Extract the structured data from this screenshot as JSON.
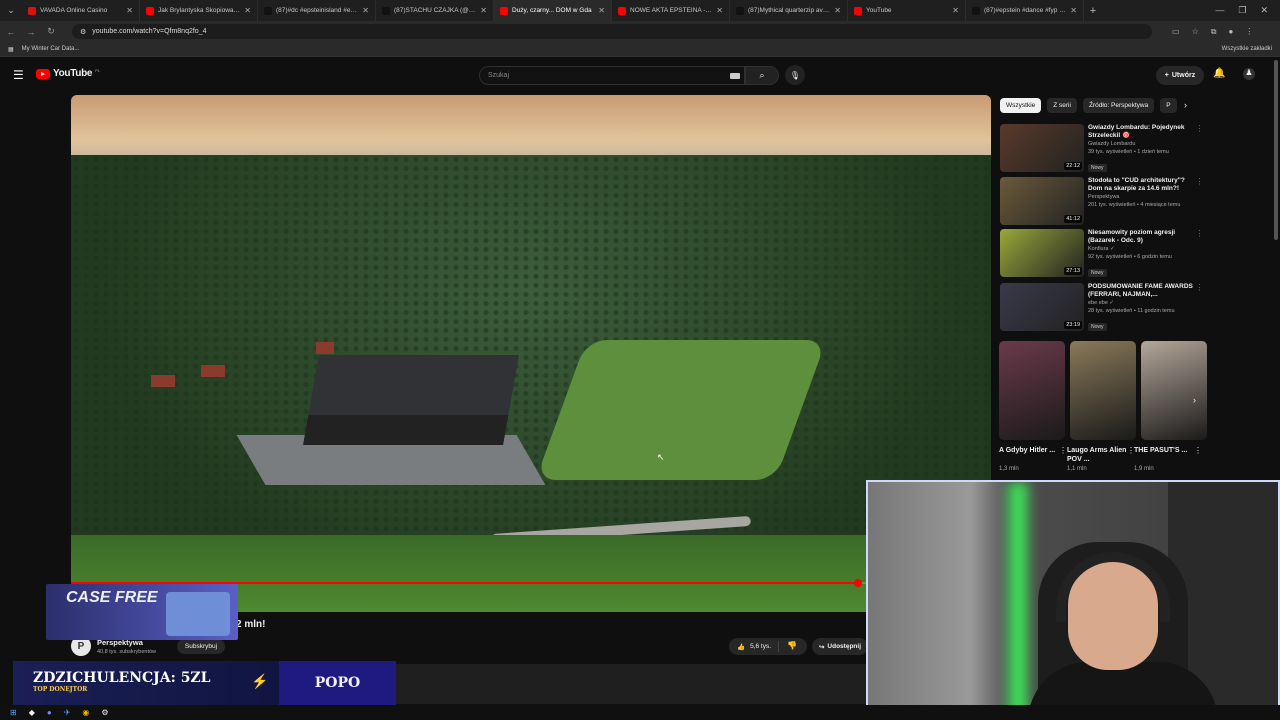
{
  "browser": {
    "tabs": [
      {
        "title": "VAVADA Online Casino",
        "color": "#d11"
      },
      {
        "title": "Jak Brylantyska Skopiowała Św",
        "color": "#f00"
      },
      {
        "title": "(87)#dc #epsteinisland #epstein",
        "color": "#111"
      },
      {
        "title": "(87)STACHU CZAJKA (@stachu",
        "color": "#111"
      },
      {
        "title": "Duży, czarny... DOM w Gda",
        "color": "#f00",
        "active": true
      },
      {
        "title": "NOWE AKTA EPSTEINA - TRUM",
        "color": "#f00"
      },
      {
        "title": "(87)Mythical quarterzip availabl",
        "color": "#111"
      },
      {
        "title": "YouTube",
        "color": "#f00"
      },
      {
        "title": "(87)#epstein #dance #fyp #me",
        "color": "#111"
      }
    ],
    "url": "youtube.com/watch?v=Qfm8nq2fo_4",
    "bookmarks": {
      "item": "My Winter Car Data...",
      "all": "Wszystkie zakładki"
    }
  },
  "youtube": {
    "logo": "YouTube",
    "logo_region": "PL",
    "search_placeholder": "Szukaj",
    "create_label": "Utwórz",
    "chips": [
      "Wszystkie",
      "Z serii",
      "Źródło: Perspektywa",
      "P"
    ],
    "recommended": [
      {
        "title": "Gwiazdy Lombardu: Pojedynek Strzeleckil 🎯",
        "channel": "Gwiazdy Lombardu",
        "views": "39 tys. wyświetleń • 1 dzień temu",
        "badge": "Nowy",
        "duration": "22:12",
        "thumb": "#5a3a2a"
      },
      {
        "title": "Stodoła to \"CUD architektury\"? Dom na skarpie za 14.6 mln?!",
        "channel": "Perspektywa",
        "views": "201 tys. wyświetleń • 4 miesiące temu",
        "badge": "",
        "duration": "41:12",
        "thumb": "#6b5a3a"
      },
      {
        "title": "Niesamowity poziom agresji (Bazarek - Odc. 9)",
        "channel": "Konfiura ✓",
        "views": "92 tys. wyświetleń • 6 godzin temu",
        "badge": "Nowy",
        "duration": "27:13",
        "thumb": "#9aa83a"
      },
      {
        "title": "PODSUMOWANIE FAME AWARDS (FERRARI, NAJMAN,...",
        "channel": "ebe ebe ✓",
        "views": "28 tys. wyświetleń • 11 godzin temu",
        "badge": "Nowy",
        "duration": "23:19",
        "thumb": "#3a3a4a"
      }
    ],
    "shorts": [
      {
        "title": "A Gdyby Hitler ...",
        "views": "1,3 mln",
        "color": "#6b3a4a"
      },
      {
        "title": "Laugo Arms Alien POV ...",
        "views": "1,1 mln",
        "color": "#8a7a5a"
      },
      {
        "title": "THE PASUT'S ...",
        "views": "1,9 mln",
        "color": "#b5a79a"
      }
    ],
    "video": {
      "title_visible": "2 mln!",
      "channel": "Perspektywa",
      "channel_initial": "P",
      "subscribers": "40,8 tys. subskrybentów",
      "subscribe_label": "Subskrybuj",
      "likes": "5,6 tys.",
      "share_label": "Udostępnij",
      "progress": 0.855
    }
  },
  "overlays": {
    "case_text": "CASE FREE",
    "donate_main": "ZDZICHULENCJA: 5ZL",
    "donate_sub": "TOP DONEJTOR",
    "donate_name": "POPO"
  }
}
